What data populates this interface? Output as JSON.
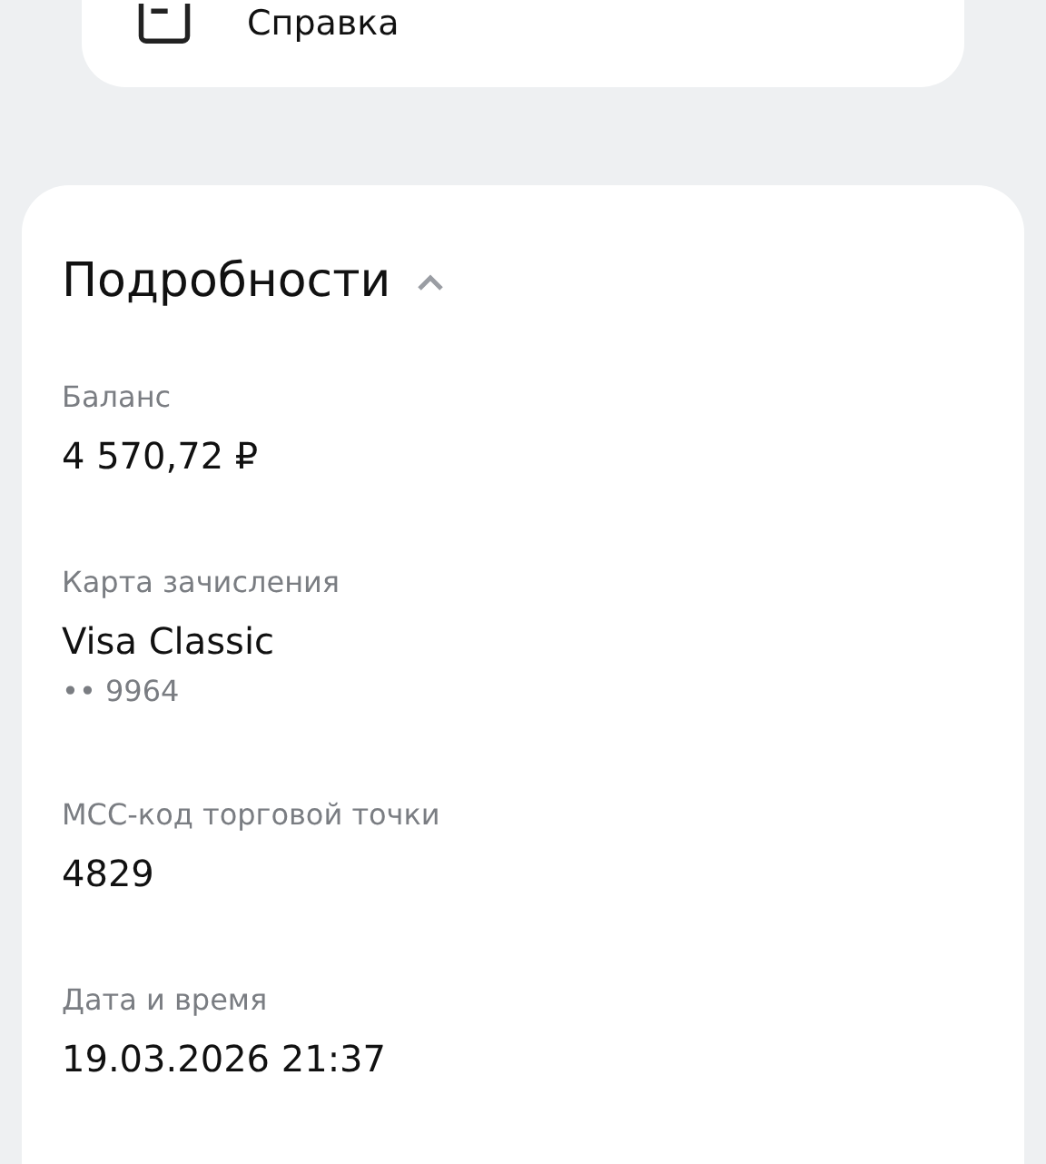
{
  "menu_card": {
    "items": [
      {
        "label": "Справка"
      }
    ]
  },
  "details": {
    "title": "Подробности",
    "expanded": true,
    "fields": [
      {
        "label": "Баланс",
        "value": "4 570,72 ₽"
      },
      {
        "label": "Карта зачисления",
        "value": "Visa Classic",
        "note": "•• 9964"
      },
      {
        "label": "МСС-код торговой точки",
        "value": "4829"
      },
      {
        "label": "Дата и время",
        "value": "19.03.2026 21:37"
      }
    ]
  }
}
